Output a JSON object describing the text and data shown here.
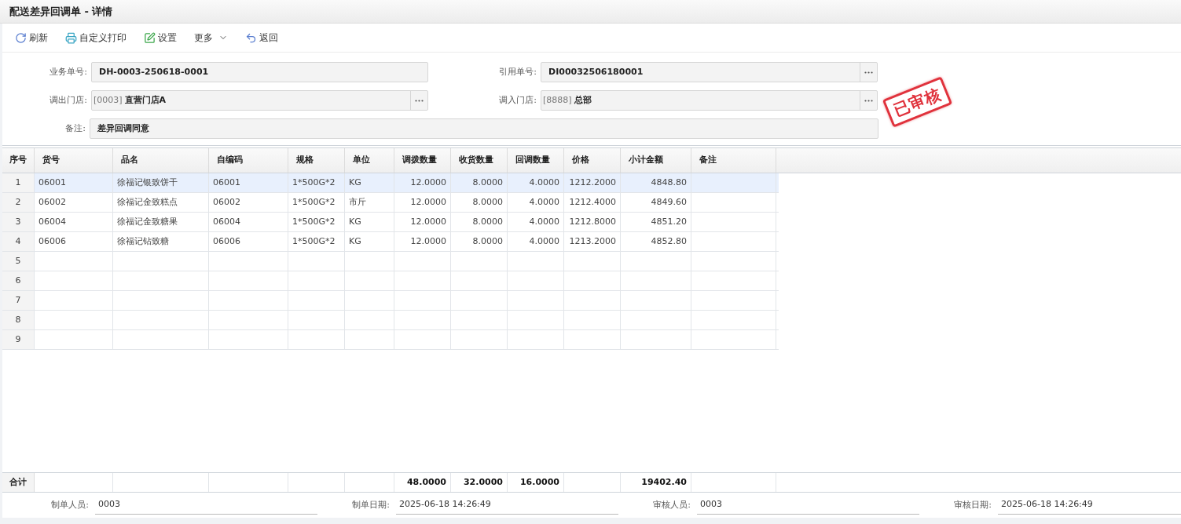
{
  "window": {
    "title": "配送差异回调单 - 详情"
  },
  "toolbar": [
    {
      "kind": "refresh",
      "label": "刷新"
    },
    {
      "kind": "print",
      "label": "自定义打印"
    },
    {
      "kind": "settings",
      "label": "设置"
    },
    {
      "kind": "more",
      "label": "更多"
    },
    {
      "kind": "back",
      "label": "返回"
    }
  ],
  "form": {
    "business_no": {
      "label": "业务单号:",
      "value": "DH-0003-250618-0001"
    },
    "reference_no": {
      "label": "引用单号:",
      "value": "DI00032506180001"
    },
    "out_store": {
      "label": "调出门店:",
      "code": "[0003]",
      "value": "直营门店A"
    },
    "in_store": {
      "label": "调入门店:",
      "code": "[8888]",
      "value": "总部"
    },
    "remark": {
      "label": "备注:",
      "value": "差异回调同意"
    }
  },
  "stamp": "已审核",
  "table": {
    "columns": [
      {
        "label": "序号",
        "kind": "index"
      },
      {
        "label": "货号",
        "kind": "text"
      },
      {
        "label": "品名",
        "kind": "text"
      },
      {
        "label": "自编码",
        "kind": "text"
      },
      {
        "label": "规格",
        "kind": "text"
      },
      {
        "label": "单位",
        "kind": "text"
      },
      {
        "label": "调拨数量",
        "kind": "number",
        "total": "48.0000"
      },
      {
        "label": "收货数量",
        "kind": "number",
        "total": "32.0000"
      },
      {
        "label": "回调数量",
        "kind": "number",
        "total": "16.0000"
      },
      {
        "label": "价格",
        "kind": "number"
      },
      {
        "label": "小计金额",
        "kind": "number",
        "total": "19402.40"
      },
      {
        "label": "备注",
        "kind": "text"
      }
    ],
    "rows": [
      {
        "selected": true,
        "cells": [
          "1",
          "06001",
          "徐福记银致饼干",
          "06001",
          "1*500G*2",
          "KG",
          "12.0000",
          "8.0000",
          "4.0000",
          "1212.2000",
          "4848.80"
        ]
      },
      {
        "selected": false,
        "cells": [
          "2",
          "06002",
          "徐福记金致糕点",
          "06002",
          "1*500G*2",
          "市斤",
          "12.0000",
          "8.0000",
          "4.0000",
          "1212.4000",
          "4849.60"
        ]
      },
      {
        "selected": false,
        "cells": [
          "3",
          "06004",
          "徐福记金致糖果",
          "06004",
          "1*500G*2",
          "KG",
          "12.0000",
          "8.0000",
          "4.0000",
          "1212.8000",
          "4851.20"
        ]
      },
      {
        "selected": false,
        "cells": [
          "4",
          "06006",
          "徐福记钻致糖",
          "06006",
          "1*500G*2",
          "KG",
          "12.0000",
          "8.0000",
          "4.0000",
          "1213.2000",
          "4852.80"
        ]
      },
      {
        "selected": false,
        "cells": [
          "5"
        ]
      },
      {
        "selected": false,
        "cells": [
          "6"
        ]
      },
      {
        "selected": false,
        "cells": [
          "7"
        ]
      },
      {
        "selected": false,
        "cells": [
          "8"
        ]
      },
      {
        "selected": false,
        "cells": [
          "9"
        ]
      }
    ],
    "total_label": "合计"
  },
  "footer": [
    {
      "label": "制单人员:",
      "value": "0003"
    },
    {
      "label": "制单日期:",
      "value": "2025-06-18 14:26:49"
    },
    {
      "label": "审核人员:",
      "value": "0003"
    },
    {
      "label": "审核日期:",
      "value": "2025-06-18 14:26:49"
    }
  ]
}
